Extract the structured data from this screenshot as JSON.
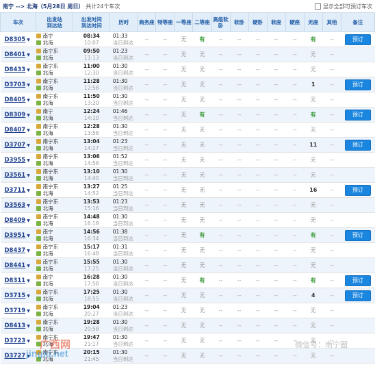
{
  "header": {
    "route": "南宁 --> 北海（5月28日 周日）",
    "count": "共计24个车次",
    "show_all_label": "显示全部可预订车次"
  },
  "columns": [
    "车次",
    "出发站",
    "到达站",
    "出发时间",
    "到达时间",
    "历时",
    "商务座",
    "特等座",
    "一等座",
    "二等座",
    "高级软卧",
    "软卧",
    "硬卧",
    "软座",
    "硬座",
    "无座",
    "其他",
    "备注"
  ],
  "rows": [
    {
      "train": "D8305",
      "from": "南宁",
      "to": "北海",
      "dep": "08:34",
      "arr": "10:07",
      "dur": "01:33",
      "note": "当日到达",
      "first": "无",
      "second": "有",
      "nonseat": "有",
      "book": "预订"
    },
    {
      "train": "D8401",
      "from": "南宁东",
      "to": "北海",
      "dep": "09:50",
      "arr": "11:13",
      "dur": "01:23",
      "note": "当日到达",
      "first": "无",
      "second": "无",
      "nonseat": "无",
      "book": ""
    },
    {
      "train": "D8433",
      "from": "南宁东",
      "to": "北海",
      "dep": "11:00",
      "arr": "12:30",
      "dur": "01:30",
      "note": "当日到达",
      "first": "无",
      "second": "无",
      "nonseat": "无",
      "book": ""
    },
    {
      "train": "D3703",
      "from": "南宁东",
      "to": "北海",
      "dep": "11:28",
      "arr": "12:58",
      "dur": "01:30",
      "note": "当日到达",
      "first": "无",
      "second": "无",
      "nonseat": "1",
      "book": "预订"
    },
    {
      "train": "D8405",
      "from": "南宁东",
      "to": "北海",
      "dep": "11:50",
      "arr": "13:20",
      "dur": "01:30",
      "note": "当日到达",
      "first": "无",
      "second": "无",
      "nonseat": "无",
      "book": ""
    },
    {
      "train": "D8309",
      "from": "南宁",
      "to": "北海",
      "dep": "12:24",
      "arr": "14:10",
      "dur": "01:46",
      "note": "当日到达",
      "first": "无",
      "second": "有",
      "nonseat": "有",
      "book": "预订"
    },
    {
      "train": "D8407",
      "from": "南宁东",
      "to": "北海",
      "dep": "12:28",
      "arr": "13:58",
      "dur": "01:30",
      "note": "当日到达",
      "first": "无",
      "second": "无",
      "nonseat": "无",
      "book": ""
    },
    {
      "train": "D3707",
      "from": "南宁东",
      "to": "北海",
      "dep": "13:04",
      "arr": "14:27",
      "dur": "01:23",
      "note": "当日到达",
      "first": "无",
      "second": "无",
      "nonseat": "11",
      "book": "预订"
    },
    {
      "train": "D3955",
      "from": "南宁东",
      "to": "北海",
      "dep": "13:06",
      "arr": "14:58",
      "dur": "01:52",
      "note": "当日到达",
      "first": "无",
      "second": "无",
      "nonseat": "无",
      "book": ""
    },
    {
      "train": "D3561",
      "from": "南宁东",
      "to": "北海",
      "dep": "13:10",
      "arr": "14:40",
      "dur": "01:30",
      "note": "当日到达",
      "first": "无",
      "second": "无",
      "nonseat": "无",
      "book": ""
    },
    {
      "train": "D3711",
      "from": "南宁东",
      "to": "北海",
      "dep": "13:27",
      "arr": "14:52",
      "dur": "01:25",
      "note": "当日到达",
      "first": "无",
      "second": "无",
      "nonseat": "16",
      "book": "预订"
    },
    {
      "train": "D3563",
      "from": "南宁东",
      "to": "北海",
      "dep": "13:53",
      "arr": "15:16",
      "dur": "01:23",
      "note": "当日到达",
      "first": "无",
      "second": "无",
      "nonseat": "无",
      "book": ""
    },
    {
      "train": "D8409",
      "from": "南宁东",
      "to": "北海",
      "dep": "14:48",
      "arr": "16:18",
      "dur": "01:30",
      "note": "当日到达",
      "first": "无",
      "second": "无",
      "nonseat": "无",
      "book": ""
    },
    {
      "train": "D3951",
      "from": "南宁",
      "to": "北海",
      "dep": "14:56",
      "arr": "16:34",
      "dur": "01:38",
      "note": "当日到达",
      "first": "无",
      "second": "有",
      "nonseat": "有",
      "book": "预订"
    },
    {
      "train": "D8437",
      "from": "南宁东",
      "to": "北海",
      "dep": "15:17",
      "arr": "16:48",
      "dur": "01:31",
      "note": "当日到达",
      "first": "无",
      "second": "无",
      "nonseat": "无",
      "book": ""
    },
    {
      "train": "D8441",
      "from": "南宁东",
      "to": "北海",
      "dep": "15:55",
      "arr": "17:25",
      "dur": "01:30",
      "note": "当日到达",
      "first": "无",
      "second": "无",
      "nonseat": "无",
      "book": ""
    },
    {
      "train": "D8311",
      "from": "南宁",
      "to": "北海",
      "dep": "16:28",
      "arr": "17:58",
      "dur": "01:30",
      "note": "当日到达",
      "first": "无",
      "second": "有",
      "nonseat": "有",
      "book": "预订"
    },
    {
      "train": "D3715",
      "from": "南宁东",
      "to": "北海",
      "dep": "17:25",
      "arr": "18:55",
      "dur": "01:30",
      "note": "当日到达",
      "first": "无",
      "second": "无",
      "nonseat": "4",
      "book": "预订"
    },
    {
      "train": "D3719",
      "from": "南宁东",
      "to": "北海",
      "dep": "19:04",
      "arr": "20:27",
      "dur": "01:23",
      "note": "当日到达",
      "first": "无",
      "second": "无",
      "nonseat": "无",
      "book": ""
    },
    {
      "train": "D8413",
      "from": "南宁东",
      "to": "北海",
      "dep": "19:28",
      "arr": "20:58",
      "dur": "01:30",
      "note": "当日到达",
      "first": "无",
      "second": "无",
      "nonseat": "无",
      "book": ""
    },
    {
      "train": "D3723",
      "from": "南宁东",
      "to": "北海",
      "dep": "19:47",
      "arr": "21:17",
      "dur": "01:30",
      "note": "当日到达",
      "first": "无",
      "second": "无",
      "nonseat": "无",
      "book": ""
    },
    {
      "train": "D3727",
      "from": "南宁东",
      "to": "北海",
      "dep": "20:15",
      "arr": "21:45",
      "dur": "01:30",
      "note": "当日到达",
      "first": "无",
      "second": "无",
      "nonseat": "无",
      "book": ""
    }
  ],
  "dash": "--",
  "watermark": {
    "line1": "广西网",
    "line2": "jingxi.net",
    "line3": "微信号：南宁圈"
  }
}
